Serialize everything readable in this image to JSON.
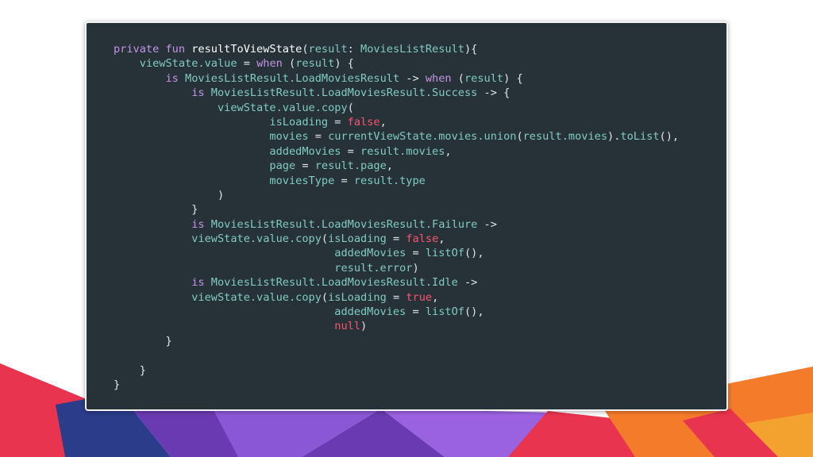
{
  "slide": {
    "background_colors": [
      "#e8344e",
      "#f47b2a",
      "#2b3c8a",
      "#7e4ec9",
      "#6a3ab2",
      "#f3a230"
    ]
  },
  "code": {
    "language": "kotlin",
    "theme": {
      "background": "#263238",
      "keyword": "#c792ea",
      "literal": "#ff5370",
      "type": "#80cbc4"
    },
    "lines": [
      [
        [
          "kw",
          "private fun "
        ],
        [
          "fn",
          "resultToViewState"
        ],
        [
          "p",
          "("
        ],
        [
          "cm",
          "result"
        ],
        [
          "p",
          ": "
        ],
        [
          "ty",
          "MoviesListResult"
        ],
        [
          "p",
          "){"
        ]
      ],
      [
        [
          "p",
          "    "
        ],
        [
          "cm",
          "viewState.value"
        ],
        [
          "p",
          " = "
        ],
        [
          "kw",
          "when"
        ],
        [
          "p",
          " ("
        ],
        [
          "cm",
          "result"
        ],
        [
          "p",
          ") {"
        ]
      ],
      [
        [
          "p",
          "        "
        ],
        [
          "kw",
          "is "
        ],
        [
          "ty",
          "MoviesListResult.LoadMoviesResult"
        ],
        [
          "p",
          " -> "
        ],
        [
          "kw",
          "when"
        ],
        [
          "p",
          " ("
        ],
        [
          "cm",
          "result"
        ],
        [
          "p",
          ") {"
        ]
      ],
      [
        [
          "p",
          "            "
        ],
        [
          "kw",
          "is "
        ],
        [
          "ty",
          "MoviesListResult.LoadMoviesResult.Success"
        ],
        [
          "p",
          " -> {"
        ]
      ],
      [
        [
          "p",
          "                "
        ],
        [
          "cm",
          "viewState.value.copy"
        ],
        [
          "p",
          "("
        ]
      ],
      [
        [
          "p",
          "                        "
        ],
        [
          "cm",
          "isLoading"
        ],
        [
          "p",
          " = "
        ],
        [
          "bool",
          "false"
        ],
        [
          "p",
          ","
        ]
      ],
      [
        [
          "p",
          "                        "
        ],
        [
          "cm",
          "movies"
        ],
        [
          "p",
          " = "
        ],
        [
          "cm",
          "currentViewState.movies.union"
        ],
        [
          "p",
          "("
        ],
        [
          "cm",
          "result.movies"
        ],
        [
          "p",
          ")."
        ],
        [
          "cm",
          "toList"
        ],
        [
          "p",
          "(),"
        ]
      ],
      [
        [
          "p",
          "                        "
        ],
        [
          "cm",
          "addedMovies"
        ],
        [
          "p",
          " = "
        ],
        [
          "cm",
          "result.movies"
        ],
        [
          "p",
          ","
        ]
      ],
      [
        [
          "p",
          "                        "
        ],
        [
          "cm",
          "page"
        ],
        [
          "p",
          " = "
        ],
        [
          "cm",
          "result.page"
        ],
        [
          "p",
          ","
        ]
      ],
      [
        [
          "p",
          "                        "
        ],
        [
          "cm",
          "moviesType"
        ],
        [
          "p",
          " = "
        ],
        [
          "cm",
          "result.type"
        ]
      ],
      [
        [
          "p",
          "                )"
        ]
      ],
      [
        [
          "p",
          "            }"
        ]
      ],
      [
        [
          "p",
          "            "
        ],
        [
          "kw",
          "is "
        ],
        [
          "ty",
          "MoviesListResult.LoadMoviesResult.Failure"
        ],
        [
          "p",
          " ->"
        ]
      ],
      [
        [
          "p",
          "            "
        ],
        [
          "cm",
          "viewState.value.copy"
        ],
        [
          "p",
          "("
        ],
        [
          "cm",
          "isLoading"
        ],
        [
          "p",
          " = "
        ],
        [
          "bool",
          "false"
        ],
        [
          "p",
          ","
        ]
      ],
      [
        [
          "p",
          "                                  "
        ],
        [
          "cm",
          "addedMovies"
        ],
        [
          "p",
          " = "
        ],
        [
          "cm",
          "listOf"
        ],
        [
          "p",
          "(),"
        ]
      ],
      [
        [
          "p",
          "                                  "
        ],
        [
          "cm",
          "result.error"
        ],
        [
          "p",
          ")"
        ]
      ],
      [
        [
          "p",
          "            "
        ],
        [
          "kw",
          "is "
        ],
        [
          "ty",
          "MoviesListResult.LoadMoviesResult.Idle"
        ],
        [
          "p",
          " ->"
        ]
      ],
      [
        [
          "p",
          "            "
        ],
        [
          "cm",
          "viewState.value.copy"
        ],
        [
          "p",
          "("
        ],
        [
          "cm",
          "isLoading"
        ],
        [
          "p",
          " = "
        ],
        [
          "bool",
          "true"
        ],
        [
          "p",
          ","
        ]
      ],
      [
        [
          "p",
          "                                  "
        ],
        [
          "cm",
          "addedMovies"
        ],
        [
          "p",
          " = "
        ],
        [
          "cm",
          "listOf"
        ],
        [
          "p",
          "(),"
        ]
      ],
      [
        [
          "p",
          "                                  "
        ],
        [
          "bool",
          "null"
        ],
        [
          "p",
          ")"
        ]
      ],
      [
        [
          "p",
          "        }"
        ]
      ],
      [
        [
          "p",
          ""
        ]
      ],
      [
        [
          "p",
          "    }"
        ]
      ],
      [
        [
          "p",
          "}"
        ]
      ]
    ]
  }
}
